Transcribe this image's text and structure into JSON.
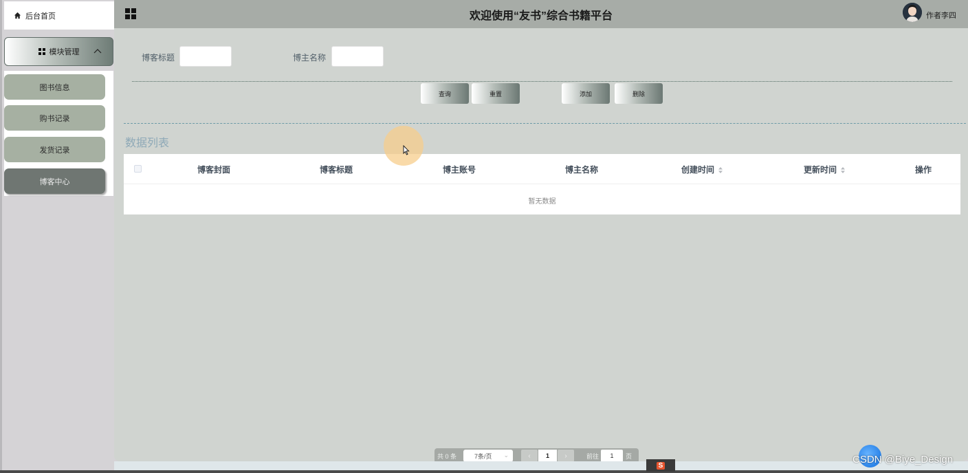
{
  "sidebar": {
    "home_label": "后台首页",
    "module_label": "模块管理",
    "items": [
      {
        "label": "图书信息"
      },
      {
        "label": "购书记录"
      },
      {
        "label": "发货记录"
      },
      {
        "label": "博客中心",
        "active": true
      }
    ]
  },
  "header": {
    "title": "欢迎使用“友书”综合书籍平台",
    "author": "作者李四"
  },
  "search": {
    "blog_title_label": "博客标题",
    "blog_title_value": "",
    "blogger_name_label": "博主名称",
    "blogger_name_value": ""
  },
  "actions": {
    "query": "查询",
    "reset": "重置",
    "add": "添加",
    "delete": "删除"
  },
  "list": {
    "title": "数据列表",
    "columns": [
      "博客封面",
      "博客标题",
      "博主账号",
      "博主名称",
      "创建时间",
      "更新时间",
      "操作"
    ],
    "empty_text": "暂无数据"
  },
  "pagination": {
    "total": "共 0 条",
    "page_size": "7条/页",
    "current_page": "1",
    "goto_label": "前往",
    "goto_value": "1",
    "page_unit": "页"
  },
  "watermark": "CSDN @Biye_Design",
  "colors": {
    "header_bg": "#a7aca7",
    "main_bg": "#d0d4d0",
    "sidebar_item": "#a6b0a2",
    "sidebar_active": "#6f7672",
    "list_title": "#8ea9b7"
  }
}
